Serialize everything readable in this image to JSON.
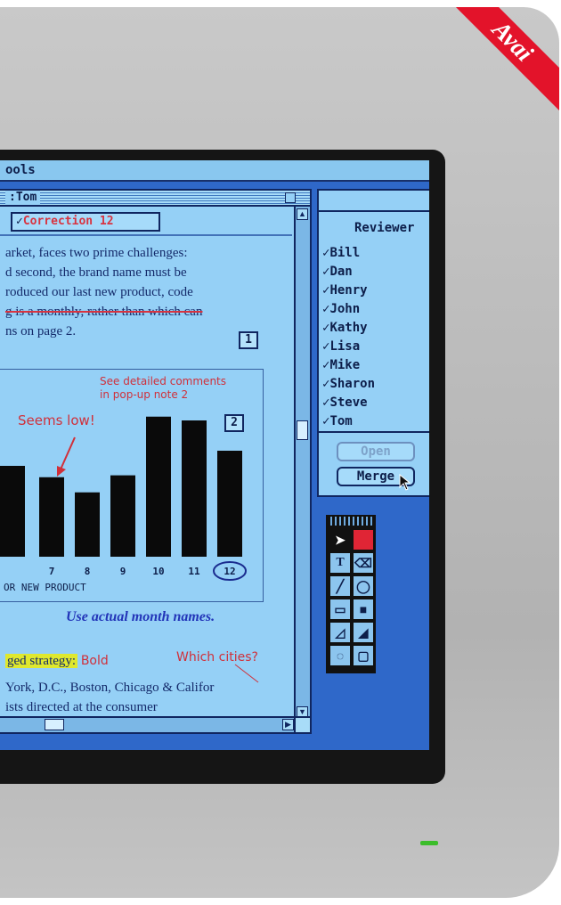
{
  "banner": {
    "text": "Avai"
  },
  "menu": {
    "title": "ools"
  },
  "doc": {
    "window_title": ":Tom",
    "note_label": "Correction 12",
    "note_check": "✓",
    "lines": [
      "arket, faces two prime challenges:",
      "d second, the brand name must be",
      "roduced our last new product, code",
      "g is a monthly, rather than which can",
      "ns on page 2."
    ],
    "section1": "1",
    "section2": "2",
    "comment_top": "See detailed comments",
    "comment_bottom": "in pop-up note 2",
    "seems_low": "Seems low!",
    "use_months": "Use actual month names.",
    "strategy_highlight": "ged strategy:",
    "bold_note": "Bold",
    "cities_note": "Which cities?",
    "line_cities": "York, D.C., Boston, Chicago & Califor",
    "line_consumer": "ists directed at the consumer"
  },
  "chart_data": {
    "type": "bar",
    "title": "",
    "xlabel": "OR NEW PRODUCT",
    "ylabel": "",
    "categories": [
      "7",
      "8",
      "9",
      "10",
      "11",
      "12"
    ],
    "values": [
      4.2,
      3.4,
      4.3,
      7.4,
      7.2,
      5.6
    ],
    "ylim": [
      0,
      8
    ],
    "highlight_category": "12",
    "bar_color": "#0a0a0a"
  },
  "reviewers": {
    "header": "Reviewer",
    "check": "✓",
    "names": [
      "Bill",
      "Dan",
      "Henry",
      "John",
      "Kathy",
      "Lisa",
      "Mike",
      "Sharon",
      "Steve",
      "Tom"
    ],
    "open_label": "Open",
    "merge_label": "Merge"
  },
  "tools": {
    "icons": [
      "arrow-tool-icon",
      "color-fill-icon",
      "text-tool-icon",
      "eraser-tool-icon",
      "line-tool-icon",
      "oval-tool-icon",
      "rectangle-tool-icon",
      "filled-rectangle-tool-icon",
      "freeform-tool-icon",
      "filled-freeform-tool-icon",
      "lasso-tool-icon",
      "rounded-rectangle-tool-icon"
    ],
    "text_glyph": "T",
    "accent_color": "#e02535"
  },
  "colors": {
    "screen_bg": "#2f68c9",
    "window_bg": "#95d0f6",
    "annotation_red": "#d0303a",
    "power_led": "#3bbd2a"
  }
}
